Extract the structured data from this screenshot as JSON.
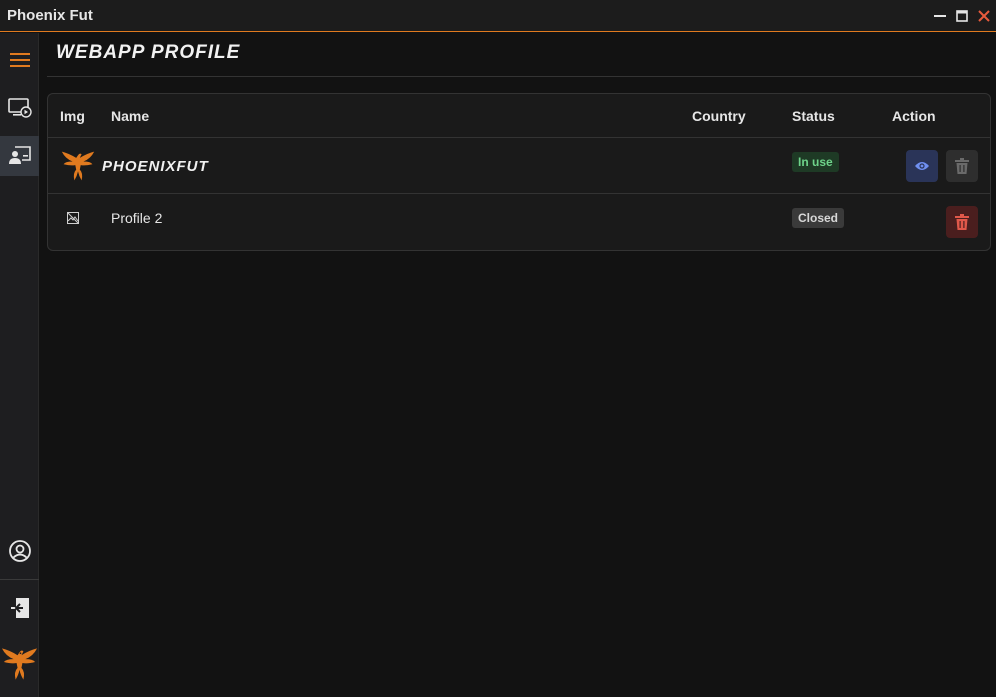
{
  "window": {
    "title": "Phoenix Fut"
  },
  "sidebar": {
    "items": [
      {
        "icon": "hamburger-menu-icon"
      },
      {
        "icon": "screen-play-icon"
      },
      {
        "icon": "user-screen-icon",
        "active": true
      }
    ],
    "bottom": [
      {
        "icon": "user-circle-icon"
      },
      {
        "icon": "logout-icon"
      },
      {
        "icon": "phoenix-logo-icon"
      }
    ]
  },
  "page": {
    "title": "WEBAPP PROFILE"
  },
  "table": {
    "columns": [
      "Img",
      "Name",
      "Country",
      "Status",
      "Action"
    ],
    "rows": [
      {
        "img": "phoenix-logo",
        "name": "PHOENIXFUT",
        "country": "",
        "status": "In use",
        "actions": [
          "view",
          "delete-disabled"
        ]
      },
      {
        "img": "broken-image",
        "name": "Profile 2",
        "country": "",
        "status": "Closed",
        "actions": [
          "delete"
        ]
      }
    ]
  },
  "colors": {
    "accent": "#e07a1f",
    "in_use": "#6ed38a",
    "delete": "#e0584a",
    "view": "#6f8ff0"
  }
}
